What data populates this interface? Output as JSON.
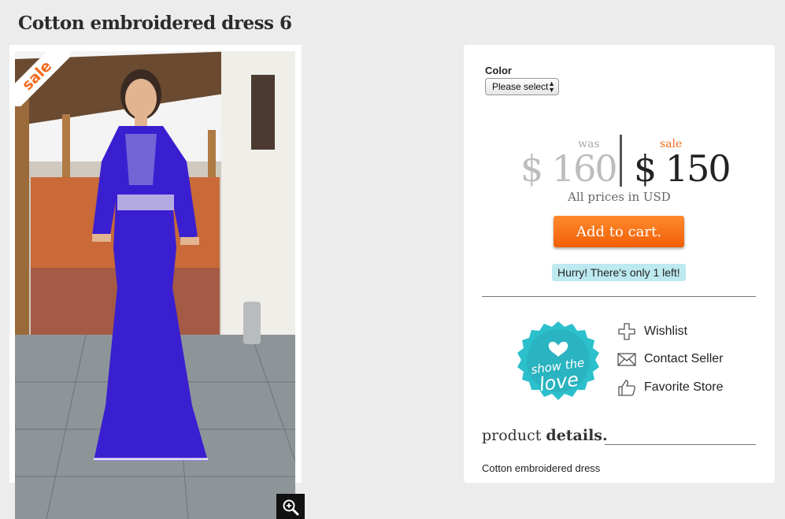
{
  "page": {
    "title": "Cotton embroidered dress 6"
  },
  "product_image": {
    "sale_ribbon": "sale",
    "zoom_icon": "magnifier-plus-icon"
  },
  "options": {
    "color_label": "Color",
    "color_select_value": "Please select"
  },
  "pricing": {
    "was_label": "was",
    "old_price": "$ 160",
    "sale_label": "sale",
    "new_price": "$ 150",
    "currency_note": "All prices in USD"
  },
  "cart": {
    "button_label": "Add to cart.",
    "stock_notice": "Hurry! There's only 1 left!"
  },
  "social": {
    "love_badge_line1": "show the",
    "love_badge_line2": "love",
    "actions": [
      {
        "label": "Wishlist",
        "icon": "plus-icon"
      },
      {
        "label": "Contact Seller",
        "icon": "envelope-icon"
      },
      {
        "label": "Favorite Store",
        "icon": "thumbs-up-icon"
      }
    ]
  },
  "details": {
    "heading_light": "product ",
    "heading_bold": "details.",
    "description": "Cotton embroidered dress"
  },
  "colors": {
    "accent_orange": "#f26b1d",
    "badge_teal": "#2cbfcc",
    "stock_bg": "#bde9f0",
    "dress_blue": "#3a1fd1"
  }
}
